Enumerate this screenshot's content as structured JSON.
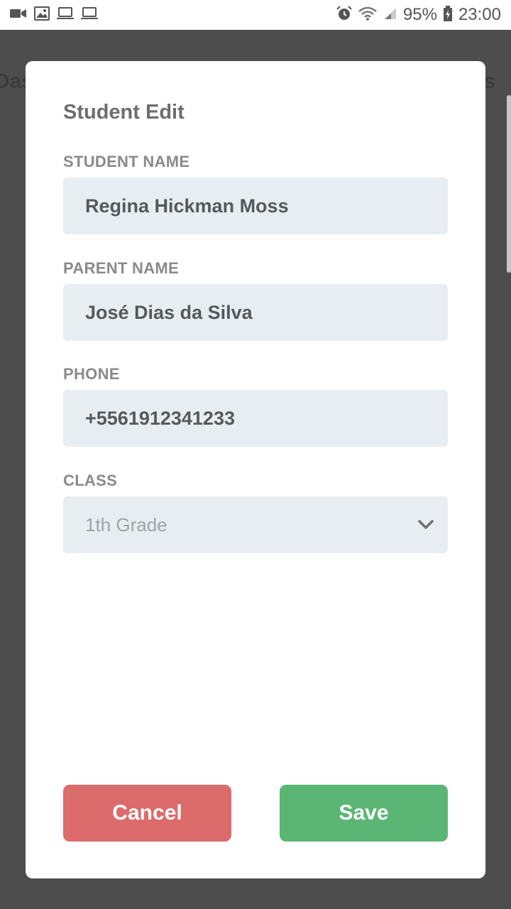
{
  "status_bar": {
    "icons_left": [
      "video-icon",
      "image-icon",
      "laptop-icon",
      "laptop-icon"
    ],
    "icons_right": [
      "alarm-icon",
      "wifi-icon",
      "signal-icon"
    ],
    "battery": "95%",
    "time": "23:00"
  },
  "background": {
    "title_left": "Das",
    "title_right": "s"
  },
  "modal": {
    "title": "Student Edit",
    "fields": {
      "student_name": {
        "label": "STUDENT NAME",
        "value": "Regina Hickman Moss"
      },
      "parent_name": {
        "label": "PARENT NAME",
        "value": "José Dias da Silva"
      },
      "phone": {
        "label": "PHONE",
        "value": "+5561912341233"
      },
      "class": {
        "label": "CLASS",
        "value": "1th Grade"
      }
    },
    "buttons": {
      "cancel": "Cancel",
      "save": "Save"
    }
  },
  "colors": {
    "overlay": "#4d4d4d",
    "field_bg": "#e8edf2",
    "cancel": "#dc6b6b",
    "save": "#5bb675"
  }
}
